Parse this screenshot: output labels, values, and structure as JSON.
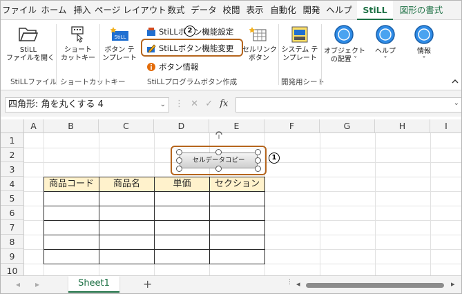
{
  "menu": {
    "tabs": [
      "ファイル",
      "ホーム",
      "挿入",
      "ページ レイアウト",
      "数式",
      "データ",
      "校閲",
      "表示",
      "自動化",
      "開発",
      "ヘルプ",
      "StiLL",
      "図形の書式"
    ]
  },
  "ribbon": {
    "open_file": {
      "line1": "StiLL",
      "line2": "ファイルを開く"
    },
    "shortcut": {
      "line1": "ショート",
      "line2": "カットキー"
    },
    "button_template": {
      "line1": "ボタン テ",
      "line2": "ンプレート"
    },
    "button_setting": "StiLLボタン機能設定",
    "button_change": "StiLLボタン機能変更",
    "button_info": "ボタン情報",
    "cell_link": {
      "line1": "セルリンク",
      "line2": "ボタン"
    },
    "system_template": {
      "line1": "システム テ",
      "line2": "ンプレート"
    },
    "object_place": {
      "line1": "オブジェクト",
      "line2": "の配置 ˅"
    },
    "help": {
      "line1": "ヘルプ",
      "line2": "˅"
    },
    "info": {
      "line1": "情報",
      "line2": "˅"
    },
    "groups": {
      "file": "StiLLファイル",
      "shortcut": "ショートカットキー",
      "program_button": "StiLLプログラムボタン作成",
      "dev_sheet": "開発用シート"
    }
  },
  "callouts": {
    "one": "1",
    "two": "2"
  },
  "formula_bar": {
    "name_box": "四角形: 角を丸くする 4",
    "fx": "fx"
  },
  "sheet": {
    "columns": [
      "A",
      "B",
      "C",
      "D",
      "E",
      "F",
      "G",
      "H",
      "I"
    ],
    "rows": [
      "1",
      "2",
      "3",
      "4",
      "5",
      "6",
      "7",
      "8",
      "9",
      "10"
    ],
    "table_headers": [
      "商品コード",
      "商品名",
      "単価",
      "セクション"
    ],
    "shape_button_label": "セルデータコピー"
  },
  "sheet_tabs": {
    "active": "Sheet1",
    "add": "+"
  },
  "colors": {
    "accent": "#1e7145",
    "callout": "#b5651d",
    "header_fill": "#fff2cc"
  }
}
